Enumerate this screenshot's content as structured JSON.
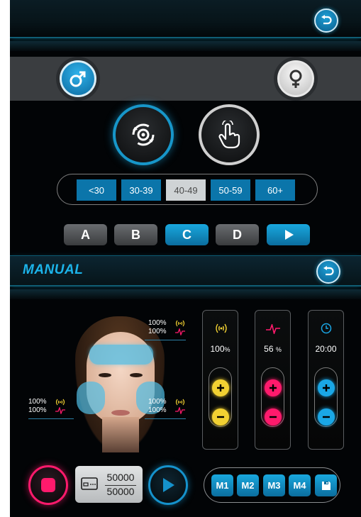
{
  "top": {
    "back_icon": "back-arrow-icon"
  },
  "gender": {
    "male_icon": "male-symbol-icon",
    "female_icon": "female-symbol-icon"
  },
  "modes": {
    "auto_icon": "auto-cycle-icon",
    "manual_icon": "hand-touch-icon"
  },
  "age_groups": {
    "items": [
      "<30",
      "30-39",
      "40-49",
      "50-59",
      "60+"
    ],
    "selected": "40-49"
  },
  "programs": {
    "items": [
      "A",
      "B",
      "C",
      "D"
    ],
    "selected": "C",
    "play_icon": "play-icon"
  },
  "manual": {
    "title": "MANUAL",
    "pads": {
      "forehead": {
        "intensity": "100%",
        "pulse": "100%"
      },
      "left_cheek": {
        "intensity": "100%",
        "pulse": "100%"
      },
      "right_cheek": {
        "intensity": "100%",
        "pulse": "100%"
      }
    },
    "controls": {
      "intensity": {
        "icon": "radio-wave-icon",
        "value": "100",
        "unit": "%",
        "color": "#f2d132"
      },
      "pulse": {
        "icon": "pulse-icon",
        "value": "56",
        "unit": "%",
        "color": "#ff1a6c"
      },
      "timer": {
        "icon": "clock-icon",
        "value": "20:00",
        "color": "#1aa7e6"
      }
    }
  },
  "bottom": {
    "stop_icon": "stop-icon",
    "counter": {
      "current": "50000",
      "total": "50000",
      "icon": "card-icon"
    },
    "play_icon": "play-icon",
    "memory": [
      "M1",
      "M2",
      "M3",
      "M4"
    ],
    "save_icon": "save-icon"
  }
}
